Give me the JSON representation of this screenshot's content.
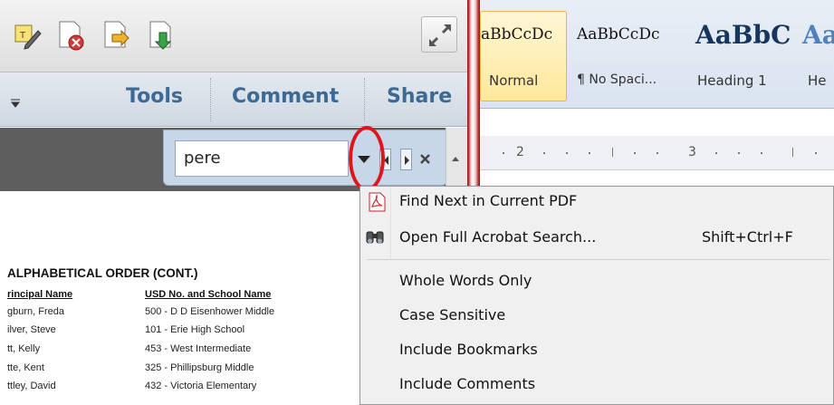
{
  "acrobat": {
    "tabs": {
      "tools": "Tools",
      "comment": "Comment",
      "share": "Share"
    },
    "find": {
      "query": "pere"
    },
    "document": {
      "title": "ALPHABETICAL ORDER (CONT.)",
      "columns": [
        "rincipal Name",
        "USD No. and School Name"
      ],
      "rows": [
        [
          "gburn, Freda",
          "500 - D D Eisenhower Middle"
        ],
        [
          "ilver, Steve",
          "101 - Erie High School"
        ],
        [
          "tt, Kelly",
          "453 - West Intermediate"
        ],
        [
          "tte, Kent",
          "325 - Phillipsburg Middle"
        ],
        [
          "ttley, David",
          "432 - Victoria Elementary"
        ]
      ]
    },
    "toolbar_icons": [
      "edit-note-icon",
      "delete-file-icon",
      "export-file-icon",
      "download-file-icon",
      "fullscreen-icon"
    ]
  },
  "word": {
    "styles": [
      {
        "preview": "aBbCcDc",
        "name": "Normal"
      },
      {
        "preview": "AaBbCcDc",
        "name": "¶ No Spaci..."
      },
      {
        "preview": "AaBbC",
        "name": "Heading 1"
      },
      {
        "preview": "Aa",
        "name": "He"
      }
    ],
    "ruler": [
      "2",
      "3"
    ]
  },
  "menu": {
    "find_next": "Find Next in Current PDF",
    "open_full_search": "Open Full Acrobat Search...",
    "open_full_search_shortcut": "Shift+Ctrl+F",
    "whole_words": "Whole Words Only",
    "case_sensitive": "Case Sensitive",
    "include_bookmarks": "Include Bookmarks",
    "include_comments": "Include Comments"
  },
  "colors": {
    "tab_text": "#3d6995",
    "highlight": "#e0141b",
    "heading_style": "#17365d"
  }
}
